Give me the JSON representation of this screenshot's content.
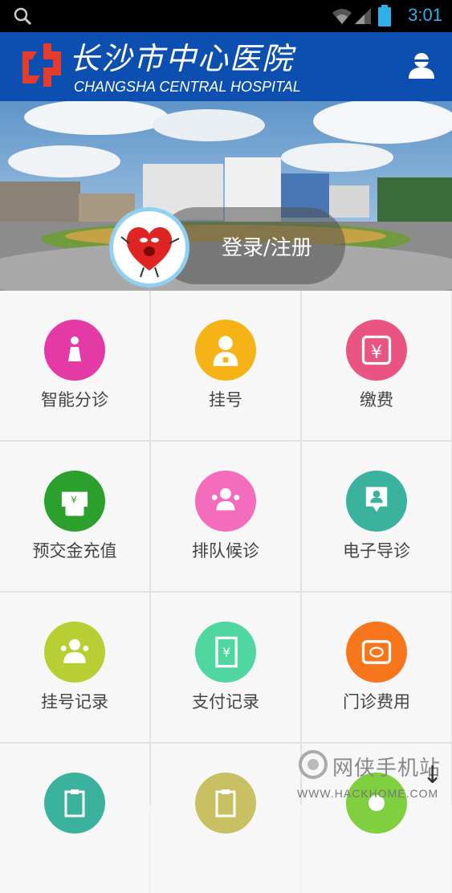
{
  "status_bar": {
    "time": "3:01"
  },
  "header": {
    "hospital_name_cn": "长沙市中心医院",
    "hospital_name_en": "CHANGSHA CENTRAL HOSPITAL"
  },
  "banner": {
    "login_label": "登录/注册"
  },
  "menu": {
    "items": [
      {
        "label": "智能分诊",
        "icon": "woman-icon",
        "color": "#e33aa6"
      },
      {
        "label": "挂号",
        "icon": "doctor-icon",
        "color": "#f5b316"
      },
      {
        "label": "缴费",
        "icon": "yen-icon",
        "color": "#e95482"
      },
      {
        "label": "预交金充值",
        "icon": "wallet-icon",
        "color": "#2ba02c"
      },
      {
        "label": "排队候诊",
        "icon": "queue-icon",
        "color": "#f36dbc"
      },
      {
        "label": "电子导诊",
        "icon": "location-guide-icon",
        "color": "#3bb29e"
      },
      {
        "label": "挂号记录",
        "icon": "people-icon",
        "color": "#b8cf33"
      },
      {
        "label": "支付记录",
        "icon": "receipt-icon",
        "color": "#4fd6a1"
      },
      {
        "label": "门诊费用",
        "icon": "card-icon",
        "color": "#f7761c"
      },
      {
        "label": "",
        "icon": "clipboard-icon",
        "color": "#3bb29e"
      },
      {
        "label": "",
        "icon": "clipboard-icon",
        "color": "#c8c063"
      },
      {
        "label": "",
        "icon": "circle-icon",
        "color": "#7fcf3f"
      }
    ]
  },
  "watermark": {
    "text": "网侠手机站",
    "url": "WWW.HACKHOME.COM"
  }
}
